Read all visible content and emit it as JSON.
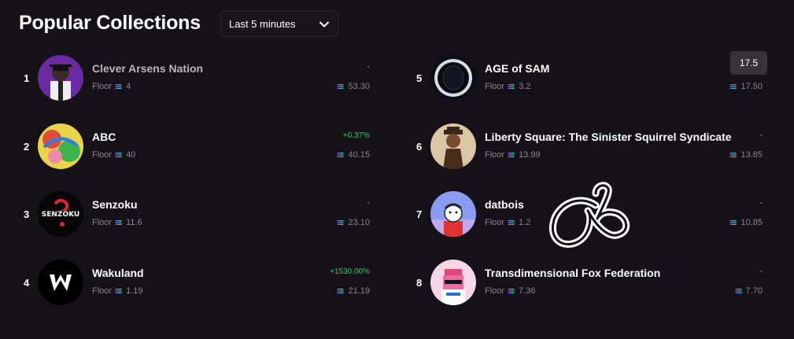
{
  "header": {
    "title": "Popular Collections",
    "timeframe": "Last 5 minutes"
  },
  "colors": {
    "background": "#161118",
    "positive": "#2ec964",
    "muted": "#8c8592",
    "sol_gradient": [
      "#9945ff",
      "#14f195"
    ]
  },
  "tooltip": {
    "value": "17.5"
  },
  "floor_label": "Floor",
  "collections": [
    {
      "rank": "1",
      "name": "Clever Arsens Nation",
      "floor": "4",
      "change": "-",
      "volume": "53.30",
      "avatar_icon": "hooded-figure-avatar"
    },
    {
      "rank": "2",
      "name": "ABC",
      "floor": "40",
      "change": "+0.37%",
      "volume": "40.15",
      "avatar_icon": "colorful-art-avatar"
    },
    {
      "rank": "3",
      "name": "Senzoku",
      "floor": "11.6",
      "change": "-",
      "volume": "23.10",
      "avatar_icon": "senzoku-logo-avatar"
    },
    {
      "rank": "4",
      "name": "Wakuland",
      "floor": "1.19",
      "change": "+1530.00%",
      "volume": "21.19",
      "avatar_icon": "wakuland-w-avatar"
    },
    {
      "rank": "5",
      "name": "AGE of SAM",
      "floor": "3.2",
      "change": "",
      "volume": "17.50",
      "avatar_icon": "helmet-avatar"
    },
    {
      "rank": "6",
      "name": "Liberty Square: The Sinister Squirrel Syndicate",
      "floor": "13.99",
      "change": "-",
      "volume": "13.85",
      "avatar_icon": "squirrel-avatar"
    },
    {
      "rank": "7",
      "name": "datbois",
      "floor": "1.2",
      "change": "-",
      "volume": "10.85",
      "avatar_icon": "cartoon-boy-avatar"
    },
    {
      "rank": "8",
      "name": "Transdimensional Fox Federation",
      "floor": "7.36",
      "change": "-",
      "volume": "7.70",
      "avatar_icon": "pixel-fox-avatar"
    }
  ]
}
